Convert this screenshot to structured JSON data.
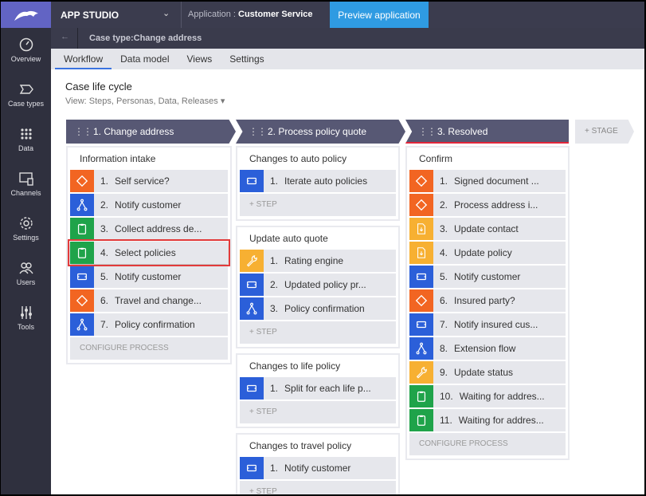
{
  "topbar": {
    "app_studio": "APP STUDIO",
    "application_label": "Application :",
    "application_name": "Customer Service",
    "preview_button": "Preview application"
  },
  "sidebar": {
    "items": [
      {
        "label": "Overview",
        "icon": "gauge-icon"
      },
      {
        "label": "Case types",
        "icon": "case-type-icon"
      },
      {
        "label": "Data",
        "icon": "grid-icon"
      },
      {
        "label": "Channels",
        "icon": "channels-icon"
      },
      {
        "label": "Settings",
        "icon": "gear-icon"
      },
      {
        "label": "Users",
        "icon": "users-icon"
      },
      {
        "label": "Tools",
        "icon": "sliders-icon"
      }
    ]
  },
  "subbar": {
    "back": "←",
    "case_type": "Case type:Change address"
  },
  "tabs": [
    {
      "label": "Workflow",
      "active": true
    },
    {
      "label": "Data model"
    },
    {
      "label": "Views"
    },
    {
      "label": "Settings"
    }
  ],
  "lifecycle": {
    "title": "Case life cycle",
    "view": "View:  Steps, Personas, Data, Releases  ▾",
    "add_stage": "+ STAGE",
    "add_step": "+ STEP",
    "configure": "CONFIGURE PROCESS"
  },
  "colors": {
    "decision": "#f26522",
    "flow": "#2b5fd9",
    "assign": "#1fa34a",
    "util": "#f7b032",
    "stage": "#575874",
    "highlight": "#e23b3b"
  },
  "stages": [
    {
      "label": "1.  Change address",
      "processes": [
        {
          "title": "Information intake",
          "footer": "configure",
          "steps": [
            {
              "num": "1.",
              "label": "Self service?",
              "type": "decision"
            },
            {
              "num": "2.",
              "label": "Notify customer",
              "type": "fork"
            },
            {
              "num": "3.",
              "label": "Collect address de...",
              "type": "assign"
            },
            {
              "num": "4.",
              "label": "Select policies",
              "type": "assign",
              "highlighted": true
            },
            {
              "num": "5.",
              "label": "Notify customer",
              "type": "subprocess"
            },
            {
              "num": "6.",
              "label": "Travel and change...",
              "type": "decision"
            },
            {
              "num": "7.",
              "label": "Policy confirmation",
              "type": "fork"
            }
          ]
        }
      ]
    },
    {
      "label": "2.  Process policy quote",
      "processes": [
        {
          "title": "Changes to auto policy",
          "footer": "step",
          "steps": [
            {
              "num": "1.",
              "label": "Iterate auto policies",
              "type": "subprocess"
            }
          ]
        },
        {
          "title": "Update auto quote",
          "footer": "step",
          "steps": [
            {
              "num": "1.",
              "label": "Rating engine",
              "type": "wrench"
            },
            {
              "num": "2.",
              "label": "Updated policy pr...",
              "type": "subprocess"
            },
            {
              "num": "3.",
              "label": "Policy confirmation",
              "type": "fork"
            }
          ]
        },
        {
          "title": "Changes to life policy",
          "footer": "step",
          "steps": [
            {
              "num": "1.",
              "label": "Split for each life p...",
              "type": "subprocess"
            }
          ]
        },
        {
          "title": "Changes to travel policy",
          "footer": "step",
          "steps": [
            {
              "num": "1.",
              "label": "Notify customer",
              "type": "subprocess"
            }
          ]
        }
      ]
    },
    {
      "label": "3.  Resolved",
      "processes": [
        {
          "title": "Confirm",
          "footer": "configure",
          "steps": [
            {
              "num": "1.",
              "label": "Signed document ...",
              "type": "decision"
            },
            {
              "num": "2.",
              "label": "Process address i...",
              "type": "decision"
            },
            {
              "num": "3.",
              "label": "Update contact",
              "type": "document"
            },
            {
              "num": "4.",
              "label": "Update policy",
              "type": "document"
            },
            {
              "num": "5.",
              "label": "Notify customer",
              "type": "subprocess"
            },
            {
              "num": "6.",
              "label": "Insured party?",
              "type": "decision"
            },
            {
              "num": "7.",
              "label": "Notify insured cus...",
              "type": "subprocess"
            },
            {
              "num": "8.",
              "label": "Extension flow",
              "type": "fork"
            },
            {
              "num": "9.",
              "label": "Update status",
              "type": "wrench"
            },
            {
              "num": "10.",
              "label": "Waiting for addres...",
              "type": "assign"
            },
            {
              "num": "11.",
              "label": "Waiting for addres...",
              "type": "assign"
            }
          ]
        }
      ]
    }
  ]
}
